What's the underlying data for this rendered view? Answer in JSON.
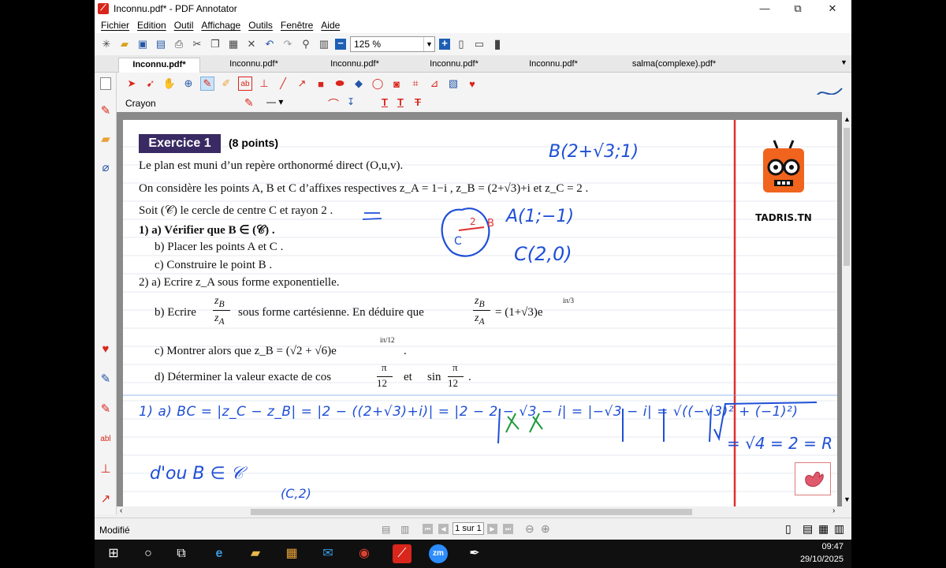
{
  "window": {
    "title": "Inconnu.pdf* - PDF Annotator",
    "minimize": "—",
    "maximize": "⧉",
    "close": "✕"
  },
  "menu": [
    "Fichier",
    "Edition",
    "Outil",
    "Affichage",
    "Outils",
    "Fenêtre",
    "Aide"
  ],
  "toolbar": {
    "zoom_value": "125 %",
    "zoom_minus": "−",
    "zoom_plus": "+"
  },
  "tabs": [
    {
      "label": "Inconnu.pdf*",
      "active": true
    },
    {
      "label": "Inconnu.pdf*",
      "active": false
    },
    {
      "label": "Inconnu.pdf*",
      "active": false
    },
    {
      "label": "Inconnu.pdf*",
      "active": false
    },
    {
      "label": "Inconnu.pdf*",
      "active": false
    },
    {
      "label": "salma(complexe).pdf*",
      "active": false
    }
  ],
  "tool": {
    "current": "Crayon",
    "accent_color": "#d9261c"
  },
  "document": {
    "exercise_title": "Exercice 1",
    "exercise_points": "(8 points)",
    "lines": {
      "l1": "Le plan est muni d’un repère orthonormé direct (O,u,v).",
      "l2": "On considère les points A, B et C d’affixes respectives z_A = 1−i , z_B = (2+√3)+i et z_C = 2 .",
      "l3": "Soit (𝒞) le cercle de centre C et rayon 2 .",
      "q1a": "1) a) Vérifier que B ∈ (𝒞) .",
      "q1b": "b) Placer les points A et C .",
      "q1c": "c) Construire le point B .",
      "q2a": "2) a) Ecrire z_A sous forme exponentielle.",
      "q2b_1": "b) Ecrire",
      "q2b_2": "sous forme cartésienne. En déduire que",
      "q2b_3": "= (1+√3)e",
      "q2c": "c) Montrer alors que z_B = (√2 + √6)e",
      "q2d_1": "d) Déterminer la valeur exacte de cos",
      "q2d_2": "et",
      "q2d_3": "sin"
    },
    "logo_text": "TADRIS.TN"
  },
  "handwriting": {
    "b_coords": "B(2+√3;1)",
    "a_coords": "A(1;−1)",
    "c_coords": "C(2,0)",
    "c_label": "C",
    "b_label": "B",
    "radius_label": "2",
    "work_line1": "1) a) BC = |z_C − z_B| = |2 − ((2+√3)+i)| = |2 − 2 − √3 − i| = |−√3 − i| = √((−√3)² + (−1)²)",
    "work_line2": "= √4 = 2 = R",
    "conclusion": "d'ou B ∈ 𝒞",
    "conclusion_sub": "(C,2)",
    "ink_color": "#1f4fd6",
    "green_ink": "#1b9a3a",
    "red_ink": "#e03030"
  },
  "status": {
    "left": "Modifié",
    "page_indicator": "1 sur 1"
  },
  "taskbar": {
    "time": "09:47",
    "date": "29/10/2025"
  }
}
